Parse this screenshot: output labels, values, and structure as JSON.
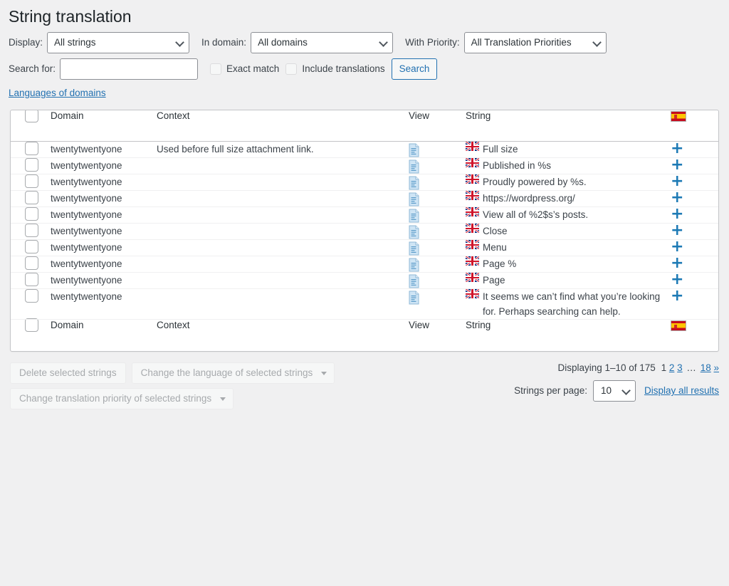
{
  "page": {
    "title": "String translation"
  },
  "filters": {
    "display_label": "Display:",
    "display_value": "All strings",
    "domain_label": "In domain:",
    "domain_value": "All domains",
    "priority_label": "With Priority:",
    "priority_value": "All Translation Priorities",
    "search_label": "Search for:",
    "search_value": "",
    "search_placeholder": "",
    "exact_match_label": "Exact match",
    "include_translations_label": "Include translations",
    "search_button": "Search",
    "languages_link": "Languages of domains"
  },
  "table": {
    "columns": {
      "domain": "Domain",
      "context": "Context",
      "view": "View",
      "string": "String",
      "flag": "spain-flag-icon"
    },
    "rows": [
      {
        "domain": "twentytwentyone",
        "context": "Used before full size attachment link.",
        "view": "document-icon",
        "flag": "uk-flag-icon",
        "string": "Full size",
        "add": "+"
      },
      {
        "domain": "twentytwentyone",
        "context": "",
        "view": "document-icon",
        "flag": "uk-flag-icon",
        "string": "Published in %s",
        "add": "+"
      },
      {
        "domain": "twentytwentyone",
        "context": "",
        "view": "document-icon",
        "flag": "uk-flag-icon",
        "string": "Proudly powered by %s.",
        "add": "+"
      },
      {
        "domain": "twentytwentyone",
        "context": "",
        "view": "document-icon",
        "flag": "uk-flag-icon",
        "string": "https://wordpress.org/",
        "add": "+"
      },
      {
        "domain": "twentytwentyone",
        "context": "",
        "view": "document-icon",
        "flag": "uk-flag-icon",
        "string": "View all of %2$s’s posts.",
        "add": "+"
      },
      {
        "domain": "twentytwentyone",
        "context": "",
        "view": "document-icon",
        "flag": "uk-flag-icon",
        "string": "Close",
        "add": "+"
      },
      {
        "domain": "twentytwentyone",
        "context": "",
        "view": "document-icon",
        "flag": "uk-flag-icon",
        "string": "Menu",
        "add": "+"
      },
      {
        "domain": "twentytwentyone",
        "context": "",
        "view": "document-icon",
        "flag": "uk-flag-icon",
        "string": "Page %",
        "add": "+"
      },
      {
        "domain": "twentytwentyone",
        "context": "",
        "view": "document-icon",
        "flag": "uk-flag-icon",
        "string": "Page",
        "add": "+"
      },
      {
        "domain": "twentytwentyone",
        "context": "",
        "view": "document-icon",
        "flag": "uk-flag-icon",
        "string": "It seems we can’t find what you’re looking for. Perhaps searching can help.",
        "add": "+"
      }
    ]
  },
  "bulk": {
    "delete_button": "Delete selected strings",
    "change_language": "Change the language of selected strings",
    "change_priority": "Change translation priority of selected strings"
  },
  "pagination": {
    "displaying": "Displaying 1–10 of 175",
    "current_page": "1",
    "pages": [
      "2",
      "3"
    ],
    "ellipsis": "…",
    "last_page": "18",
    "next": "»",
    "per_page_label": "Strings per page:",
    "per_page_value": "10",
    "display_all": "Display all results"
  },
  "colors": {
    "accent": "#2271b1",
    "plus": "#1d7ab5",
    "background": "#f0f0f1",
    "card": "#ffffff",
    "border": "#c3c4c7"
  }
}
